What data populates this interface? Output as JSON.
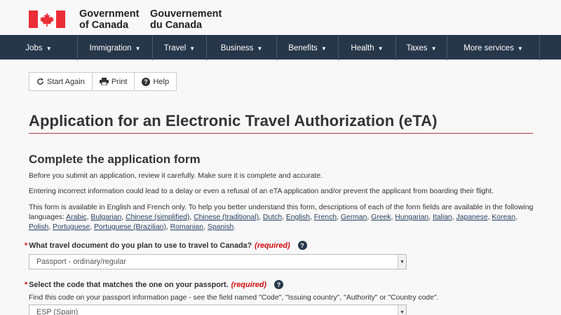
{
  "header": {
    "brand_en_line1": "Government",
    "brand_en_line2": "of Canada",
    "brand_fr_line1": "Gouvernement",
    "brand_fr_line2": "du Canada",
    "flag_icon": "canada-flag-icon",
    "colors": {
      "flag_red": "#eb2d37",
      "nav_bg": "#26374a",
      "rule": "#af3c43"
    }
  },
  "nav": {
    "items": [
      {
        "label": "Jobs"
      },
      {
        "label": "Immigration"
      },
      {
        "label": "Travel"
      },
      {
        "label": "Business"
      },
      {
        "label": "Benefits"
      },
      {
        "label": "Health"
      },
      {
        "label": "Taxes"
      },
      {
        "label": "More services"
      }
    ]
  },
  "toolbar": {
    "start_again": "Start Again",
    "print": "Print",
    "help": "Help"
  },
  "page": {
    "title": "Application for an Electronic Travel Authorization (eTA)",
    "subtitle": "Complete the application form",
    "para1": "Before you submit an application, review it carefully. Make sure it is complete and accurate.",
    "para2": "Entering incorrect information could lead to a delay or even a refusal of an eTA application and/or prevent the applicant from boarding their flight.",
    "para3_intro": "This form is available in English and French only. To help you better understand this form, descriptions of each of the form fields are available in the following languages:",
    "languages": [
      "Arabic",
      "Bulgarian",
      "Chinese (simplified)",
      "Chinese (traditional)",
      "Dutch",
      "English",
      "French",
      "German",
      "Greek",
      "Hungarian",
      "Italian",
      "Japanese",
      "Korean",
      "Polish",
      "Portuguese",
      "Portuguese (Brazilian)",
      "Romanian",
      "Spanish"
    ]
  },
  "form": {
    "q1_label": "What travel document do you plan to use to travel to Canada?",
    "q1_required": "(required)",
    "q1_value": "Passport - ordinary/regular",
    "q2_label": "Select the code that matches the one on your passport.",
    "q2_required": "(required)",
    "q2_hint": "Find this code on your passport information page - see the field named \"Code\", \"Issuing country\", \"Authority\" or \"Country code\".",
    "q2_value": "ESP (Spain)"
  }
}
